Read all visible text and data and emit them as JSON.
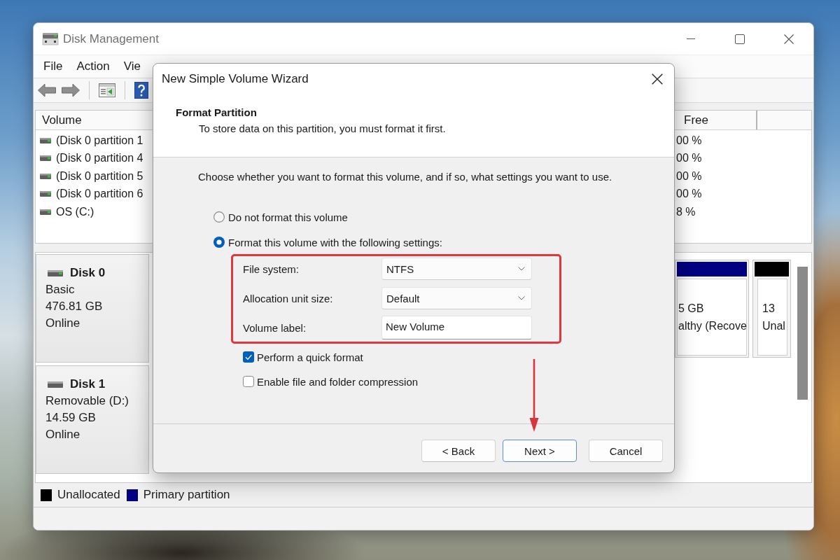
{
  "window": {
    "title": "Disk Management"
  },
  "menu": [
    "File",
    "Action",
    "Vie"
  ],
  "volume_list": {
    "columns": [
      {
        "label": "Volume"
      },
      {
        "label": "Free"
      }
    ],
    "rows": [
      {
        "volume": "(Disk 0 partition 1",
        "free": "00 %"
      },
      {
        "volume": "(Disk 0 partition 4",
        "free": "00 %"
      },
      {
        "volume": "(Disk 0 partition 5",
        "free": "00 %"
      },
      {
        "volume": "(Disk 0 partition 6",
        "free": "00 %"
      },
      {
        "volume": "OS (C:)",
        "free": "8 %"
      }
    ]
  },
  "disks": [
    {
      "name": "Disk 0",
      "kind": "fixed",
      "type": "Basic",
      "size": "476.81 GB",
      "status": "Online",
      "partitions": [
        {
          "size": "5 GB",
          "status": "althy (Recove",
          "color": "#000080"
        },
        {
          "size": "13",
          "status": "Unal",
          "color": "#000000"
        }
      ]
    },
    {
      "name": "Disk 1",
      "kind": "removable",
      "type": "Removable (D:)",
      "size": "14.59 GB",
      "status": "Online"
    }
  ],
  "legend": [
    {
      "label": "Unallocated",
      "color": "#000000"
    },
    {
      "label": "Primary partition",
      "color": "#000080"
    }
  ],
  "dialog": {
    "title": "New Simple Volume Wizard",
    "heading": "Format Partition",
    "subheading": "To store data on this partition, you must format it first.",
    "prompt": "Choose whether you want to format this volume, and if so, what settings you want to use.",
    "options": [
      {
        "label": "Do not format this volume",
        "selected": false
      },
      {
        "label": "Format this volume with the following settings:",
        "selected": true
      }
    ],
    "settings": {
      "highlighted": true,
      "fields": [
        {
          "kind": "dropdown",
          "label": "File system:",
          "value": "NTFS"
        },
        {
          "kind": "dropdown",
          "label": "Allocation unit size:",
          "value": "Default"
        },
        {
          "kind": "text",
          "label": "Volume label:",
          "value": "New Volume"
        }
      ]
    },
    "checkboxes": [
      {
        "label": "Perform a quick format",
        "checked": true
      },
      {
        "label": "Enable file and folder compression",
        "checked": false
      }
    ],
    "buttons": [
      {
        "label": "< Back",
        "default": false
      },
      {
        "label": "Next >",
        "default": true
      },
      {
        "label": "Cancel",
        "default": false
      }
    ]
  }
}
